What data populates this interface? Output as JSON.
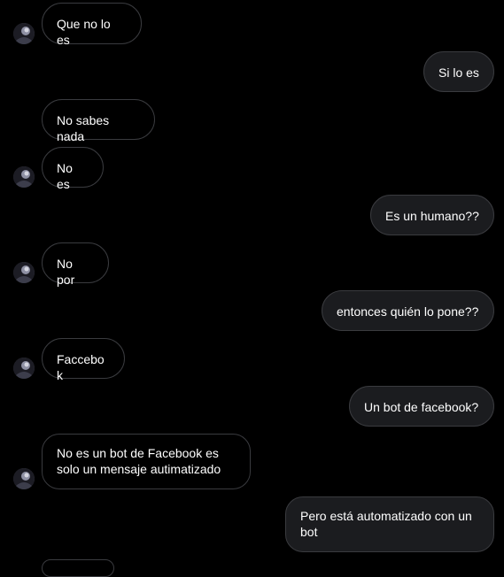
{
  "conversation": {
    "messages": [
      {
        "side": "incoming",
        "text": "Que no lo es"
      },
      {
        "side": "outgoing",
        "text": "Si lo es"
      },
      {
        "side": "incoming",
        "text": "No sabes nada"
      },
      {
        "side": "incoming",
        "text": "No es"
      },
      {
        "side": "outgoing",
        "text": "Es un humano??"
      },
      {
        "side": "incoming",
        "text": "No por"
      },
      {
        "side": "outgoing",
        "text": "entonces quién lo pone??"
      },
      {
        "side": "incoming",
        "text": "Faccebok"
      },
      {
        "side": "outgoing",
        "text": "Un bot de facebook?"
      },
      {
        "side": "incoming",
        "text": "No es un bot de Facebook es solo un mensaje autimatizado"
      },
      {
        "side": "outgoing",
        "text": "Pero está automatizado con un bot"
      }
    ]
  },
  "colors": {
    "background": "#000000",
    "incoming_bubble": "#000000",
    "outgoing_bubble": "#1b1c1f",
    "bubble_border": "#3a3b3f",
    "text": "#ffffff"
  },
  "icons": {
    "contact_avatar": "contact-avatar"
  }
}
